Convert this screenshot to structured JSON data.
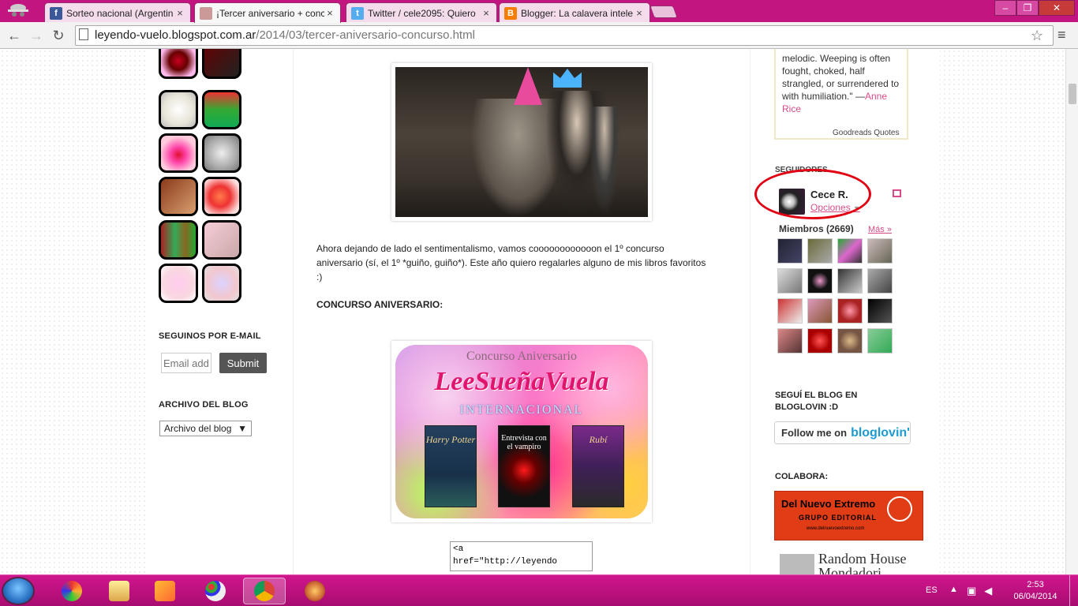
{
  "browser": {
    "tabs": [
      {
        "title": "Sorteo nacional (Argentin",
        "icon": "facebook-icon",
        "color": "#3b5998",
        "active": false
      },
      {
        "title": "¡Tercer aniversario + conc",
        "icon": "blog-favicon",
        "color": "#c99",
        "active": true
      },
      {
        "title": "Twitter / cele2095: Quiero",
        "icon": "twitter-icon",
        "color": "#55acee",
        "active": false
      },
      {
        "title": "Blogger: La calavera intele",
        "icon": "blogger-icon",
        "color": "#f57d00",
        "active": false
      }
    ],
    "url_domain": "leyendo-vuelo.blogspot.com.ar",
    "url_path": "/2014/03/tercer-aniversario-concurso.html"
  },
  "left_sidebar": {
    "email_title": "SEGUINOS POR E-MAIL",
    "email_placeholder": "Email address...",
    "submit_label": "Submit",
    "archive_title": "ARCHIVO DEL BLOG",
    "archive_select": "Archivo del blog"
  },
  "post": {
    "paragraph": "Ahora dejando de lado el sentimentalismo, vamos coooooooooooon el 1º concurso aniversario (sí, el 1º *guiño, guiño*). Este año quiero regalarles alguno de mis libros favoritos :)",
    "heading": "CONCURSO ANIVERSARIO:",
    "banner": {
      "top": "Concurso Aniversario",
      "brand": "LeeSueñaVuela",
      "intl": "INTERNACIONAL",
      "books": [
        "Harry Potter",
        "Entrevista con el vampiro",
        "Rubí"
      ]
    },
    "code": "<a\nhref=\"http://leyendo"
  },
  "right_sidebar": {
    "quote": "melodic. Weeping is often fought, choked, half strangled, or surrendered to with humiliation.\" —",
    "quote_author": "Anne Rice",
    "quote_source": "Goodreads Quotes",
    "followers_title": "SEGUIDORES",
    "user_name": "Cece R.",
    "user_options": "Opciones",
    "members": "Miembros (2669)",
    "more": "Más »",
    "bloglovin_title": "SEGUÍ EL BLOG EN BLOGLOVIN :D",
    "bloglovin_follow": "Follow me on",
    "bloglovin_brand": "bloglovin'",
    "colabora_title": "COLABORA:",
    "partner1_name": "Del Nuevo Extremo",
    "partner1_sub": "GRUPO EDITORIAL",
    "partner1_url": "www.delnuevoextremo.com",
    "partner2_line1": "Random House",
    "partner2_line2": "Mondadori"
  },
  "taskbar": {
    "language": "ES",
    "time": "2:53",
    "date": "06/04/2014"
  }
}
